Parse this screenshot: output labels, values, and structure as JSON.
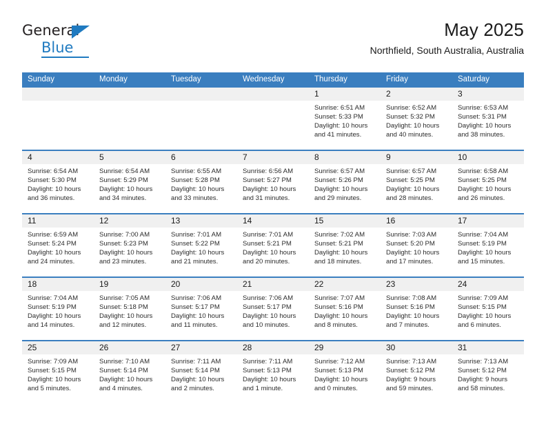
{
  "logo": {
    "word_top": "General",
    "word_bottom": "Blue",
    "accent_color": "#1f7ac0"
  },
  "header": {
    "title": "May 2025",
    "location": "Northfield, South Australia, Australia"
  },
  "theme": {
    "header_blue": "#3a7ebf",
    "number_band": "#f0f0f0"
  },
  "weekdays": [
    "Sunday",
    "Monday",
    "Tuesday",
    "Wednesday",
    "Thursday",
    "Friday",
    "Saturday"
  ],
  "labels": {
    "sunrise_prefix": "Sunrise:",
    "sunset_prefix": "Sunset:",
    "daylight_prefix": "Daylight:"
  },
  "weeks": [
    [
      {
        "day": "",
        "l1": "",
        "l2": "",
        "l3": ""
      },
      {
        "day": "",
        "l1": "",
        "l2": "",
        "l3": ""
      },
      {
        "day": "",
        "l1": "",
        "l2": "",
        "l3": ""
      },
      {
        "day": "",
        "l1": "",
        "l2": "",
        "l3": ""
      },
      {
        "day": "1",
        "l1": "Sunrise: 6:51 AM",
        "l2": "Sunset: 5:33 PM",
        "l3": "Daylight: 10 hours and 41 minutes."
      },
      {
        "day": "2",
        "l1": "Sunrise: 6:52 AM",
        "l2": "Sunset: 5:32 PM",
        "l3": "Daylight: 10 hours and 40 minutes."
      },
      {
        "day": "3",
        "l1": "Sunrise: 6:53 AM",
        "l2": "Sunset: 5:31 PM",
        "l3": "Daylight: 10 hours and 38 minutes."
      }
    ],
    [
      {
        "day": "4",
        "l1": "Sunrise: 6:54 AM",
        "l2": "Sunset: 5:30 PM",
        "l3": "Daylight: 10 hours and 36 minutes."
      },
      {
        "day": "5",
        "l1": "Sunrise: 6:54 AM",
        "l2": "Sunset: 5:29 PM",
        "l3": "Daylight: 10 hours and 34 minutes."
      },
      {
        "day": "6",
        "l1": "Sunrise: 6:55 AM",
        "l2": "Sunset: 5:28 PM",
        "l3": "Daylight: 10 hours and 33 minutes."
      },
      {
        "day": "7",
        "l1": "Sunrise: 6:56 AM",
        "l2": "Sunset: 5:27 PM",
        "l3": "Daylight: 10 hours and 31 minutes."
      },
      {
        "day": "8",
        "l1": "Sunrise: 6:57 AM",
        "l2": "Sunset: 5:26 PM",
        "l3": "Daylight: 10 hours and 29 minutes."
      },
      {
        "day": "9",
        "l1": "Sunrise: 6:57 AM",
        "l2": "Sunset: 5:25 PM",
        "l3": "Daylight: 10 hours and 28 minutes."
      },
      {
        "day": "10",
        "l1": "Sunrise: 6:58 AM",
        "l2": "Sunset: 5:25 PM",
        "l3": "Daylight: 10 hours and 26 minutes."
      }
    ],
    [
      {
        "day": "11",
        "l1": "Sunrise: 6:59 AM",
        "l2": "Sunset: 5:24 PM",
        "l3": "Daylight: 10 hours and 24 minutes."
      },
      {
        "day": "12",
        "l1": "Sunrise: 7:00 AM",
        "l2": "Sunset: 5:23 PM",
        "l3": "Daylight: 10 hours and 23 minutes."
      },
      {
        "day": "13",
        "l1": "Sunrise: 7:01 AM",
        "l2": "Sunset: 5:22 PM",
        "l3": "Daylight: 10 hours and 21 minutes."
      },
      {
        "day": "14",
        "l1": "Sunrise: 7:01 AM",
        "l2": "Sunset: 5:21 PM",
        "l3": "Daylight: 10 hours and 20 minutes."
      },
      {
        "day": "15",
        "l1": "Sunrise: 7:02 AM",
        "l2": "Sunset: 5:21 PM",
        "l3": "Daylight: 10 hours and 18 minutes."
      },
      {
        "day": "16",
        "l1": "Sunrise: 7:03 AM",
        "l2": "Sunset: 5:20 PM",
        "l3": "Daylight: 10 hours and 17 minutes."
      },
      {
        "day": "17",
        "l1": "Sunrise: 7:04 AM",
        "l2": "Sunset: 5:19 PM",
        "l3": "Daylight: 10 hours and 15 minutes."
      }
    ],
    [
      {
        "day": "18",
        "l1": "Sunrise: 7:04 AM",
        "l2": "Sunset: 5:19 PM",
        "l3": "Daylight: 10 hours and 14 minutes."
      },
      {
        "day": "19",
        "l1": "Sunrise: 7:05 AM",
        "l2": "Sunset: 5:18 PM",
        "l3": "Daylight: 10 hours and 12 minutes."
      },
      {
        "day": "20",
        "l1": "Sunrise: 7:06 AM",
        "l2": "Sunset: 5:17 PM",
        "l3": "Daylight: 10 hours and 11 minutes."
      },
      {
        "day": "21",
        "l1": "Sunrise: 7:06 AM",
        "l2": "Sunset: 5:17 PM",
        "l3": "Daylight: 10 hours and 10 minutes."
      },
      {
        "day": "22",
        "l1": "Sunrise: 7:07 AM",
        "l2": "Sunset: 5:16 PM",
        "l3": "Daylight: 10 hours and 8 minutes."
      },
      {
        "day": "23",
        "l1": "Sunrise: 7:08 AM",
        "l2": "Sunset: 5:16 PM",
        "l3": "Daylight: 10 hours and 7 minutes."
      },
      {
        "day": "24",
        "l1": "Sunrise: 7:09 AM",
        "l2": "Sunset: 5:15 PM",
        "l3": "Daylight: 10 hours and 6 minutes."
      }
    ],
    [
      {
        "day": "25",
        "l1": "Sunrise: 7:09 AM",
        "l2": "Sunset: 5:15 PM",
        "l3": "Daylight: 10 hours and 5 minutes."
      },
      {
        "day": "26",
        "l1": "Sunrise: 7:10 AM",
        "l2": "Sunset: 5:14 PM",
        "l3": "Daylight: 10 hours and 4 minutes."
      },
      {
        "day": "27",
        "l1": "Sunrise: 7:11 AM",
        "l2": "Sunset: 5:14 PM",
        "l3": "Daylight: 10 hours and 2 minutes."
      },
      {
        "day": "28",
        "l1": "Sunrise: 7:11 AM",
        "l2": "Sunset: 5:13 PM",
        "l3": "Daylight: 10 hours and 1 minute."
      },
      {
        "day": "29",
        "l1": "Sunrise: 7:12 AM",
        "l2": "Sunset: 5:13 PM",
        "l3": "Daylight: 10 hours and 0 minutes."
      },
      {
        "day": "30",
        "l1": "Sunrise: 7:13 AM",
        "l2": "Sunset: 5:12 PM",
        "l3": "Daylight: 9 hours and 59 minutes."
      },
      {
        "day": "31",
        "l1": "Sunrise: 7:13 AM",
        "l2": "Sunset: 5:12 PM",
        "l3": "Daylight: 9 hours and 58 minutes."
      }
    ]
  ]
}
